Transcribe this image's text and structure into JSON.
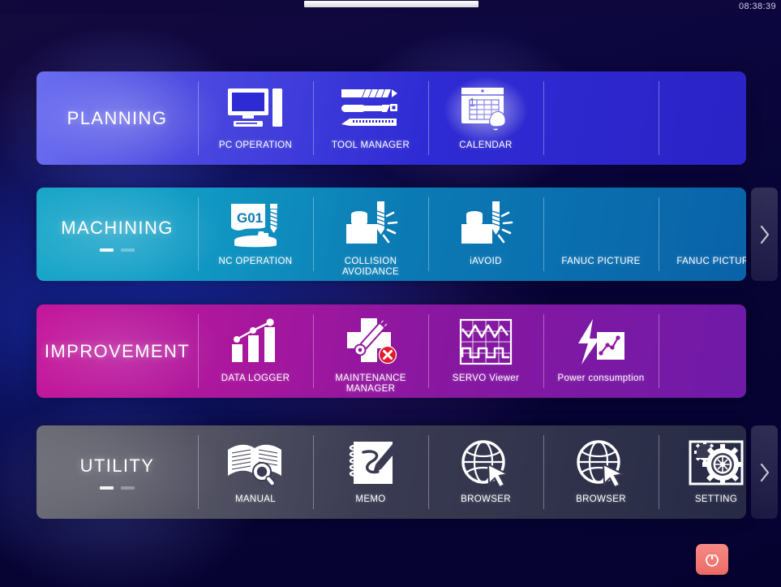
{
  "topbar": {
    "clock": "08:38:39",
    "progress_label": ""
  },
  "rows": [
    {
      "id": "planning",
      "label": "PLANNING",
      "accent": "#3a33d6",
      "pager": null,
      "has_next": false,
      "tiles": [
        {
          "label": "PC OPERATION",
          "icon": "monitor-icon",
          "selected": false
        },
        {
          "label": "TOOL MANAGER",
          "icon": "cutting-tools-icon",
          "selected": false
        },
        {
          "label": "CALENDAR",
          "icon": "calendar-bell-icon",
          "selected": true
        },
        {
          "label": "",
          "icon": "",
          "selected": false
        },
        {
          "label": "",
          "icon": "",
          "selected": false
        }
      ]
    },
    {
      "id": "machining",
      "label": "MACHINING",
      "accent": "#0b7ab4",
      "pager": {
        "count": 2,
        "active": 0
      },
      "has_next": true,
      "tiles": [
        {
          "label": "NC OPERATION",
          "icon": "g01-program-icon",
          "selected": false
        },
        {
          "label": "COLLISION\nAVOIDANCE",
          "icon": "collision-drill-icon",
          "selected": false
        },
        {
          "label": "iAVOID",
          "icon": "avoid-drill-icon",
          "selected": false
        },
        {
          "label": "FANUC PICTURE",
          "icon": "",
          "selected": false
        },
        {
          "label": "FANUC PICTURE",
          "icon": "",
          "selected": false
        }
      ]
    },
    {
      "id": "improvement",
      "label": "IMPROVEMENT",
      "accent": "#8a17a0",
      "pager": null,
      "has_next": false,
      "tiles": [
        {
          "label": "DATA LOGGER",
          "icon": "bar-chart-trend-icon",
          "selected": false
        },
        {
          "label": "MAINTENANCE\nMANAGER",
          "icon": "wrench-cross-error-icon",
          "selected": false
        },
        {
          "label": "SERVO Viewer",
          "icon": "oscilloscope-icon",
          "selected": false
        },
        {
          "label": "Power consumption",
          "icon": "power-chart-icon",
          "selected": false
        },
        {
          "label": "",
          "icon": "",
          "selected": false
        }
      ]
    },
    {
      "id": "utility",
      "label": "UTILITY",
      "accent": "#3a3b52",
      "pager": {
        "count": 2,
        "active": 0
      },
      "has_next": true,
      "tiles": [
        {
          "label": "MANUAL",
          "icon": "book-search-icon",
          "selected": false
        },
        {
          "label": "MEMO",
          "icon": "notepad-pencil-icon",
          "selected": false
        },
        {
          "label": "BROWSER",
          "icon": "globe-cursor-icon",
          "selected": false
        },
        {
          "label": "BROWSER",
          "icon": "globe-cursor-icon",
          "selected": false
        },
        {
          "label": "SETTING",
          "icon": "gears-frame-icon",
          "selected": false
        }
      ]
    }
  ],
  "next_button": {
    "icon": "chevron-right-icon",
    "label": ""
  },
  "power_button": {
    "icon": "power-icon",
    "label": "",
    "color": "#ec6a65"
  }
}
